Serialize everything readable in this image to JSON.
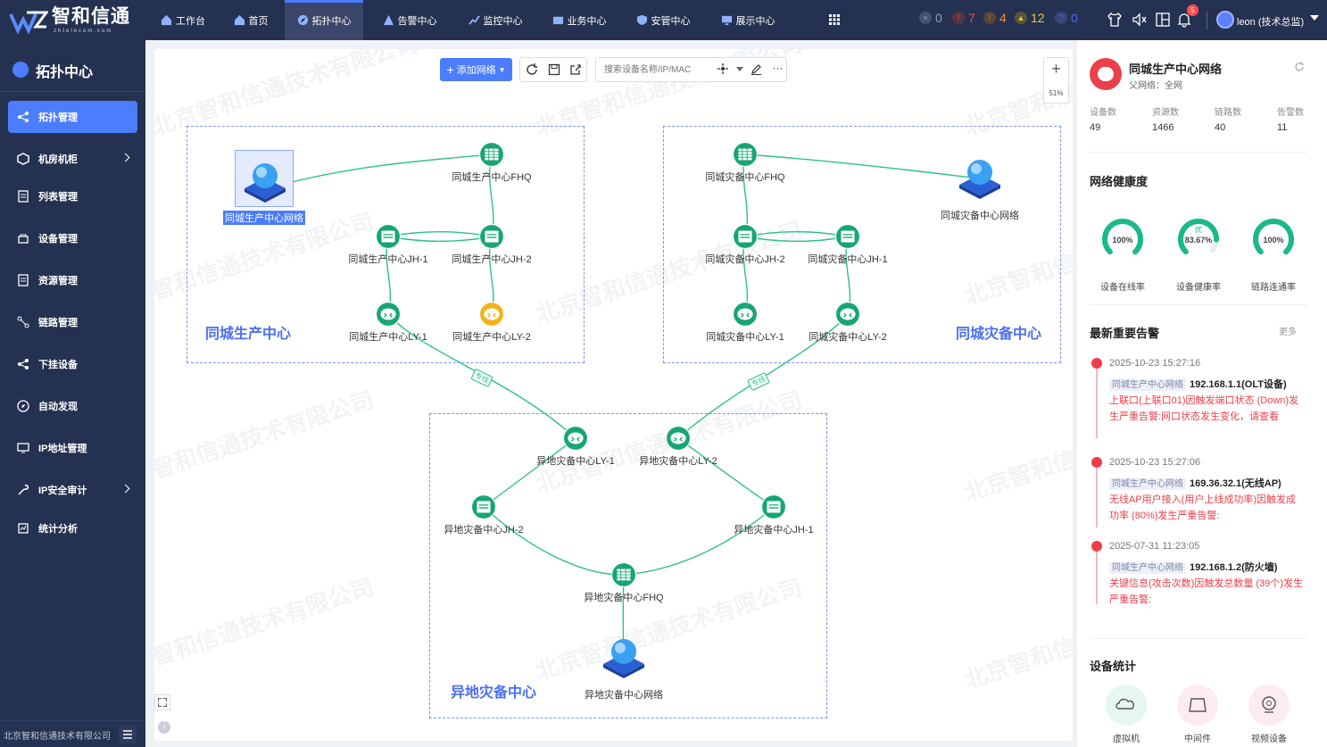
{
  "brand": {
    "name": "智和信通",
    "sub": "zhtelecom.com"
  },
  "nav": [
    {
      "label": "工作台"
    },
    {
      "label": "首页"
    },
    {
      "label": "拓扑中心"
    },
    {
      "label": "告警中心"
    },
    {
      "label": "监控中心"
    },
    {
      "label": "业务中心"
    },
    {
      "label": "安管中心"
    },
    {
      "label": "展示中心"
    }
  ],
  "counters": [
    {
      "value": "0",
      "color": "#9aa3b8"
    },
    {
      "value": "7",
      "color": "#f0444c"
    },
    {
      "value": "4",
      "color": "#f28c3a"
    },
    {
      "value": "12",
      "color": "#e7c53a"
    },
    {
      "value": "0",
      "color": "#4d67ff"
    }
  ],
  "notif_count": "5",
  "user": "leon (技术总监)",
  "sidebar": {
    "title": "拓扑中心",
    "items": [
      {
        "label": "拓扑管理"
      },
      {
        "label": "机房机柜"
      },
      {
        "label": "列表管理"
      },
      {
        "label": "设备管理"
      },
      {
        "label": "资源管理"
      },
      {
        "label": "链路管理"
      },
      {
        "label": "下挂设备"
      },
      {
        "label": "自动发现"
      },
      {
        "label": "IP地址管理"
      },
      {
        "label": "IP安全审计"
      },
      {
        "label": "统计分析"
      }
    ],
    "footer": "北京智和信通技术有限公司"
  },
  "toolbar": {
    "add_label": "添加网络",
    "search_placeholder": "搜索设备名称/IP/MAC",
    "zoom": "51%"
  },
  "watermark": "北京智和信通技术有限公司",
  "groups": [
    {
      "title": "同城生产中心"
    },
    {
      "title": "同城灾备中心"
    },
    {
      "title": "异地灾备中心"
    }
  ],
  "nodes": [
    {
      "id": "n1",
      "label": "同城生产中心网络",
      "kind": "cloud"
    },
    {
      "id": "n2",
      "label": "同城生产中心FHQ",
      "kind": "fw"
    },
    {
      "id": "n3",
      "label": "同城生产中心JH-1",
      "kind": "sw"
    },
    {
      "id": "n4",
      "label": "同城生产中心JH-2",
      "kind": "sw"
    },
    {
      "id": "n5",
      "label": "同城生产中心LY-1",
      "kind": "rt"
    },
    {
      "id": "n6",
      "label": "同城生产中心LY-2",
      "kind": "rt-warn"
    },
    {
      "id": "n7",
      "label": "同城灾备中心FHQ",
      "kind": "fw"
    },
    {
      "id": "n8",
      "label": "同城灾备中心网络",
      "kind": "cloud"
    },
    {
      "id": "n9",
      "label": "同城灾备中心JH-2",
      "kind": "sw"
    },
    {
      "id": "n10",
      "label": "同城灾备中心JH-1",
      "kind": "sw"
    },
    {
      "id": "n11",
      "label": "同城灾备中心LY-1",
      "kind": "rt"
    },
    {
      "id": "n12",
      "label": "同城灾备中心LY-2",
      "kind": "rt"
    },
    {
      "id": "n13",
      "label": "异地灾备中心LY-1",
      "kind": "rt"
    },
    {
      "id": "n14",
      "label": "异地灾备中心LY-2",
      "kind": "rt"
    },
    {
      "id": "n15",
      "label": "异地灾备中心JH-2",
      "kind": "sw"
    },
    {
      "id": "n16",
      "label": "异地灾备中心JH-1",
      "kind": "sw"
    },
    {
      "id": "n17",
      "label": "异地灾备中心FHQ",
      "kind": "fw"
    },
    {
      "id": "n18",
      "label": "异地灾备中心网络",
      "kind": "cloud"
    }
  ],
  "edge_tag": "专线",
  "right": {
    "title": "同城生产中心网络",
    "parent": "父网络：全网",
    "stats": [
      {
        "label": "设备数",
        "value": "49"
      },
      {
        "label": "资源数",
        "value": "1466"
      },
      {
        "label": "链路数",
        "value": "40"
      },
      {
        "label": "告警数",
        "value": "11"
      }
    ],
    "health_title": "网络健康度",
    "gauges": [
      {
        "label": "设备在线率",
        "text": "100%",
        "grade": "",
        "pct": 100
      },
      {
        "label": "设备健康率",
        "text": "83.67%",
        "grade": "优",
        "pct": 83.67
      },
      {
        "label": "链路连通率",
        "text": "100%",
        "grade": "",
        "pct": 100
      }
    ],
    "alarms_title": "最新重要告警",
    "more": "更多",
    "alarms": [
      {
        "time": "2025-10-23 15:27:16",
        "tag": "同城生产中心网络",
        "ip": "192.168.1.1(OLT设备)",
        "msg": "上联口(上联口01)因触发端口状态 (Down)发生严重告警:网口状态发生变化，请查看"
      },
      {
        "time": "2025-10-23 15:27:06",
        "tag": "同城生产中心网络",
        "ip": "169.36.32.1(无线AP)",
        "msg": "无线AP用户接入(用户上线成功率)因触发成功率 (80%)发生严重告警:"
      },
      {
        "time": "2025-07-31 11:23:05",
        "tag": "同城生产中心网络",
        "ip": "192.168.1.2(防火墙)",
        "msg": "关键信息(攻击次数)因触发总数量 (39个)发生严重告警:"
      }
    ],
    "device_stats_title": "设备统计",
    "device_stats": [
      {
        "label": "虚拟机",
        "color": "#e6f7f1"
      },
      {
        "label": "中间件",
        "color": "#fdecef"
      },
      {
        "label": "视频设备",
        "color": "#fdecef"
      }
    ]
  }
}
